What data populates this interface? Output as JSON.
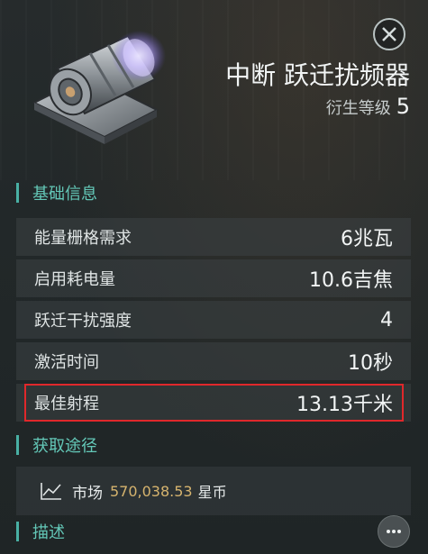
{
  "item": {
    "title": "中断 跃迁扰频器",
    "meta_label": "衍生等级",
    "meta_level": "5"
  },
  "sections": {
    "basic": "基础信息",
    "acquire": "获取途径",
    "description": "描述"
  },
  "stats": [
    {
      "label": "能量栅格需求",
      "value": "6兆瓦"
    },
    {
      "label": "启用耗电量",
      "value": "10.6吉焦"
    },
    {
      "label": "跃迁干扰强度",
      "value": "4"
    },
    {
      "label": "激活时间",
      "value": "10秒"
    },
    {
      "label": "最佳射程",
      "value": "13.13千米"
    }
  ],
  "market": {
    "label": "市场",
    "price": "570,038.53",
    "currency": "星币"
  },
  "icons": {
    "close": "close-icon",
    "market": "chart-line-icon",
    "more": "more-dots-icon"
  },
  "colors": {
    "accent": "#63c7b7",
    "price": "#d6b46e",
    "highlight": "#e0282b"
  }
}
